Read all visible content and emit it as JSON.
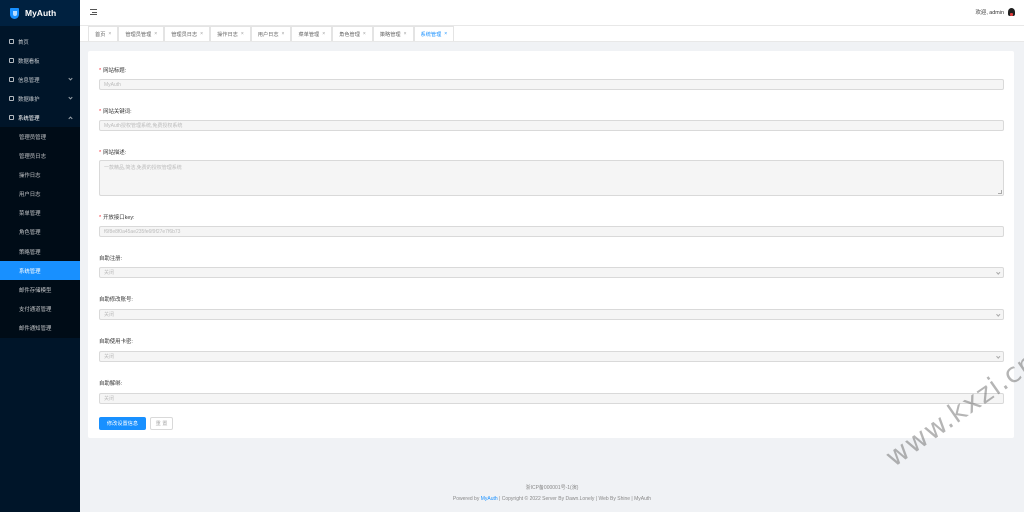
{
  "app": {
    "name": "MyAuth"
  },
  "header": {
    "welcome": "欢迎, admin"
  },
  "sidebar": {
    "items": [
      {
        "label": "首页",
        "icon": "home-icon"
      },
      {
        "label": "数据看板",
        "icon": "dashboard-icon"
      },
      {
        "label": "信息管理",
        "icon": "info-icon"
      },
      {
        "label": "数据维护",
        "icon": "database-icon"
      },
      {
        "label": "系统管理",
        "icon": "gear-icon"
      }
    ],
    "submenu": [
      "管理员管理",
      "管理员日志",
      "操作日志",
      "用户日志",
      "菜单管理",
      "角色管理",
      "策略管理",
      "系统管理",
      "邮件存储模型",
      "支付通道管理",
      "邮件通知管理"
    ]
  },
  "tabs": [
    "首页",
    "管理员管理",
    "管理员日志",
    "操作日志",
    "用户日志",
    "菜单管理",
    "角色管理",
    "策略管理",
    "系统管理"
  ],
  "form": {
    "site_title": {
      "label": "网站标题:",
      "value": "MyAuth"
    },
    "site_keywords": {
      "label": "网站关键词:",
      "value": "MyAuth授权管理系统,免费授权系统"
    },
    "site_description": {
      "label": "网站描述:",
      "value": "一款精品,简洁,免费的授权管理系统"
    },
    "api_key": {
      "label": "开放接口key:",
      "value": "f6f8e8f0a45ae235fe6f9f27e7f6b73"
    },
    "auto_register": {
      "label": "自助注册:",
      "value": "关闭"
    },
    "auto_edit_account": {
      "label": "自助修改账号:",
      "value": "关闭"
    },
    "auto_use_card": {
      "label": "自助使用卡密:",
      "value": "关闭"
    },
    "auto_unbind": {
      "label": "自助解绑:",
      "value": "关闭"
    }
  },
  "buttons": {
    "save": "修改设置信息",
    "reset": "重 置"
  },
  "footer": {
    "icp": "浙ICP备000001号-1(演)",
    "powered_prefix": "Powered by",
    "powered_link": "MyAuth",
    "powered_rest": "| Copyright © 2022 Server By Dawn.Lonely | Web By Shine | MyAuth"
  },
  "watermark": "www.kxzi.cn",
  "colors": {
    "accent": "#1890ff",
    "sidebar": "#001529",
    "required": "#f5222d"
  }
}
